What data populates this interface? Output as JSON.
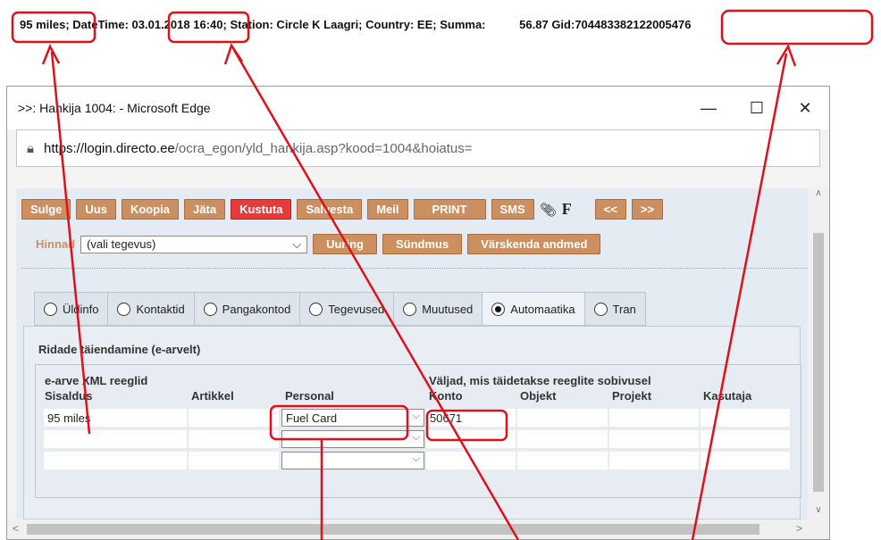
{
  "topline": {
    "fuel": "95 miles;",
    "datetime_label": "DateTime:",
    "date": "03.01.2018",
    "time": "16:40;",
    "station": "Station: Circle K Laagri;",
    "country": "Country: EE;",
    "summa_label": "Summa:",
    "summa_value": "56.87",
    "gid_label": "Gid:",
    "gid_value": "704483382122005476"
  },
  "window": {
    "title": ">>: Hankija 1004: - Microsoft Edge",
    "minimize": "—",
    "maximize": "☐",
    "close": "✕",
    "url_domain": "https://login.directo.ee",
    "url_path": "/ocra_egon/yld_hankija.asp?kood=1004&hoiatus="
  },
  "toolbar": {
    "buttons": [
      "Sulge",
      "Uus",
      "Koopia",
      "Jäta",
      "Kustuta",
      "Salvesta",
      "Meil",
      "PRINT",
      "SMS"
    ],
    "prev": "<<",
    "next": ">>",
    "f_icon": "F"
  },
  "row2": {
    "label": "Hinnad",
    "select_value": "(vali tegevus)",
    "buttons": [
      "Uuring",
      "Sündmus",
      "Värskenda andmed"
    ]
  },
  "tabs": [
    "Üldinfo",
    "Kontaktid",
    "Pangakontod",
    "Tegevused",
    "Muutused",
    "Automaatika",
    "Tran"
  ],
  "panel": {
    "title": "Ridade täiendamine (e-arvelt)",
    "group1": "e-arve XML reeglid",
    "group2": "Väljad, mis täidetakse reeglite sobivusel",
    "columns": [
      "Sisaldus",
      "Artikkel",
      "Personal",
      "Konto",
      "Objekt",
      "Projekt",
      "Kasutaja"
    ],
    "rows": [
      {
        "sisaldus": "95 miles",
        "personal": "Fuel Card",
        "konto": "50671"
      },
      {
        "sisaldus": "",
        "personal": "",
        "konto": ""
      },
      {
        "sisaldus": "",
        "personal": "",
        "konto": ""
      }
    ]
  },
  "annotation_color": "#e0101a"
}
